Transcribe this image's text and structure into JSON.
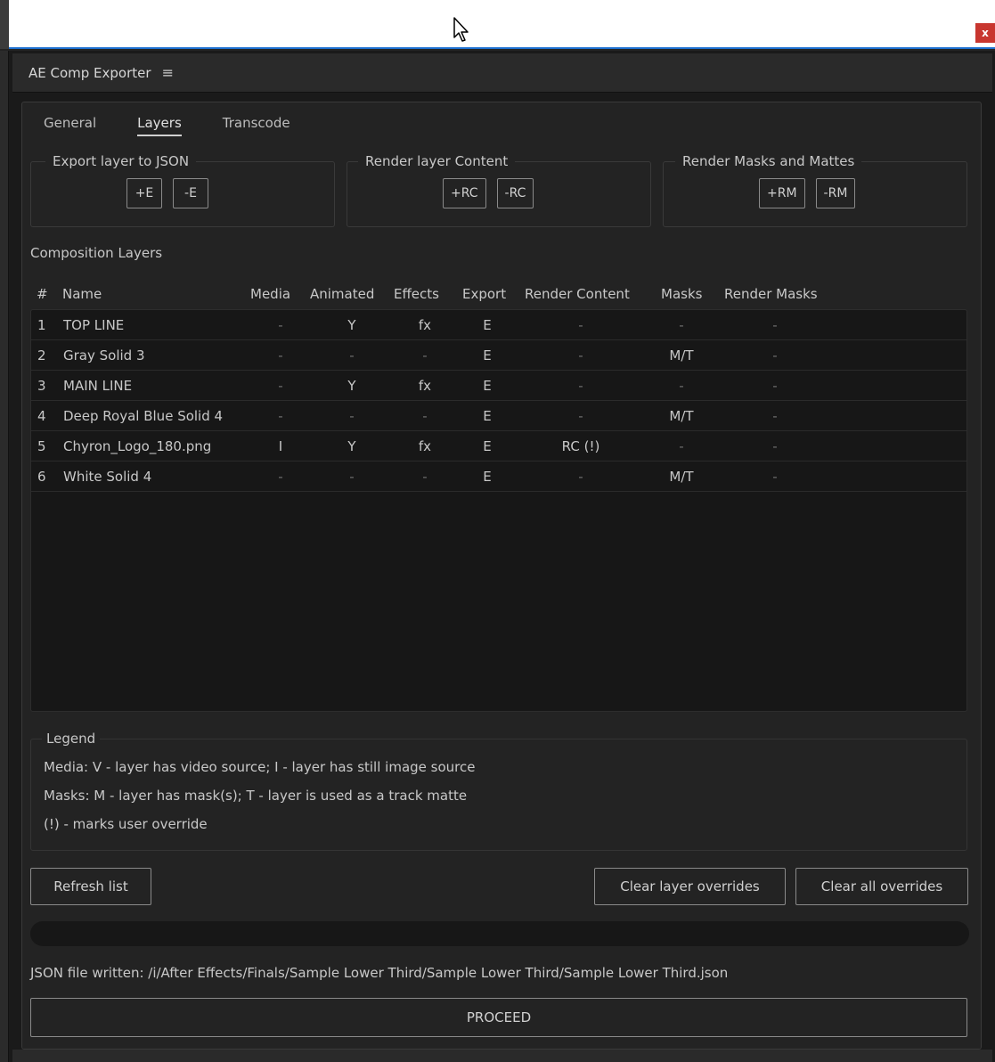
{
  "window": {
    "close_label": "x"
  },
  "panel": {
    "title": "AE Comp Exporter",
    "menu_icon": "hamburger-menu-icon"
  },
  "tabs": [
    {
      "label": "General",
      "active": false
    },
    {
      "label": "Layers",
      "active": true
    },
    {
      "label": "Transcode",
      "active": false
    }
  ],
  "groups": {
    "export": {
      "title": "Export layer to JSON",
      "add": "+E",
      "remove": "-E"
    },
    "render_content": {
      "title": "Render layer Content",
      "add": "+RC",
      "remove": "-RC"
    },
    "render_masks": {
      "title": "Render Masks and Mattes",
      "add": "+RM",
      "remove": "-RM"
    }
  },
  "layers_section": {
    "label": "Composition Layers"
  },
  "table": {
    "columns": [
      "#",
      "Name",
      "Media",
      "Animated",
      "Effects",
      "Export",
      "Render Content",
      "Masks",
      "Render Masks"
    ],
    "rows": [
      {
        "num": "1",
        "name": "TOP LINE",
        "media": "-",
        "animated": "Y",
        "effects": "fx",
        "export": "E",
        "render_content": "-",
        "masks": "-",
        "render_masks": "-"
      },
      {
        "num": "2",
        "name": "Gray Solid 3",
        "media": "-",
        "animated": "-",
        "effects": "-",
        "export": "E",
        "render_content": "-",
        "masks": "M/T",
        "render_masks": "-"
      },
      {
        "num": "3",
        "name": "MAIN LINE",
        "media": "-",
        "animated": "Y",
        "effects": "fx",
        "export": "E",
        "render_content": "-",
        "masks": "-",
        "render_masks": "-"
      },
      {
        "num": "4",
        "name": "Deep Royal Blue Solid 4",
        "media": "-",
        "animated": "-",
        "effects": "-",
        "export": "E",
        "render_content": "-",
        "masks": "M/T",
        "render_masks": "-"
      },
      {
        "num": "5",
        "name": "Chyron_Logo_180.png",
        "media": "I",
        "animated": "Y",
        "effects": "fx",
        "export": "E",
        "render_content": "RC (!)",
        "masks": "-",
        "render_masks": "-"
      },
      {
        "num": "6",
        "name": "White Solid 4",
        "media": "-",
        "animated": "-",
        "effects": "-",
        "export": "E",
        "render_content": "-",
        "masks": "M/T",
        "render_masks": "-"
      }
    ]
  },
  "legend": {
    "title": "Legend",
    "lines": [
      "Media:  V - layer has video source;   I - layer has still image source",
      "Masks: M - layer has mask(s);  T - layer is used as a track matte",
      "(!) - marks user override"
    ]
  },
  "actions": {
    "refresh": "Refresh list",
    "clear_layer": "Clear layer overrides",
    "clear_all": "Clear all overrides"
  },
  "progress": {
    "value": 0
  },
  "status": "JSON file written: /i/After Effects/Finals/Sample Lower Third/Sample Lower Third/Sample Lower Third.json",
  "proceed": "PROCEED",
  "colors": {
    "background": "#232323",
    "table_bg": "#171717",
    "close_red": "#c8362f",
    "accent_blue": "#1c6fd0"
  }
}
